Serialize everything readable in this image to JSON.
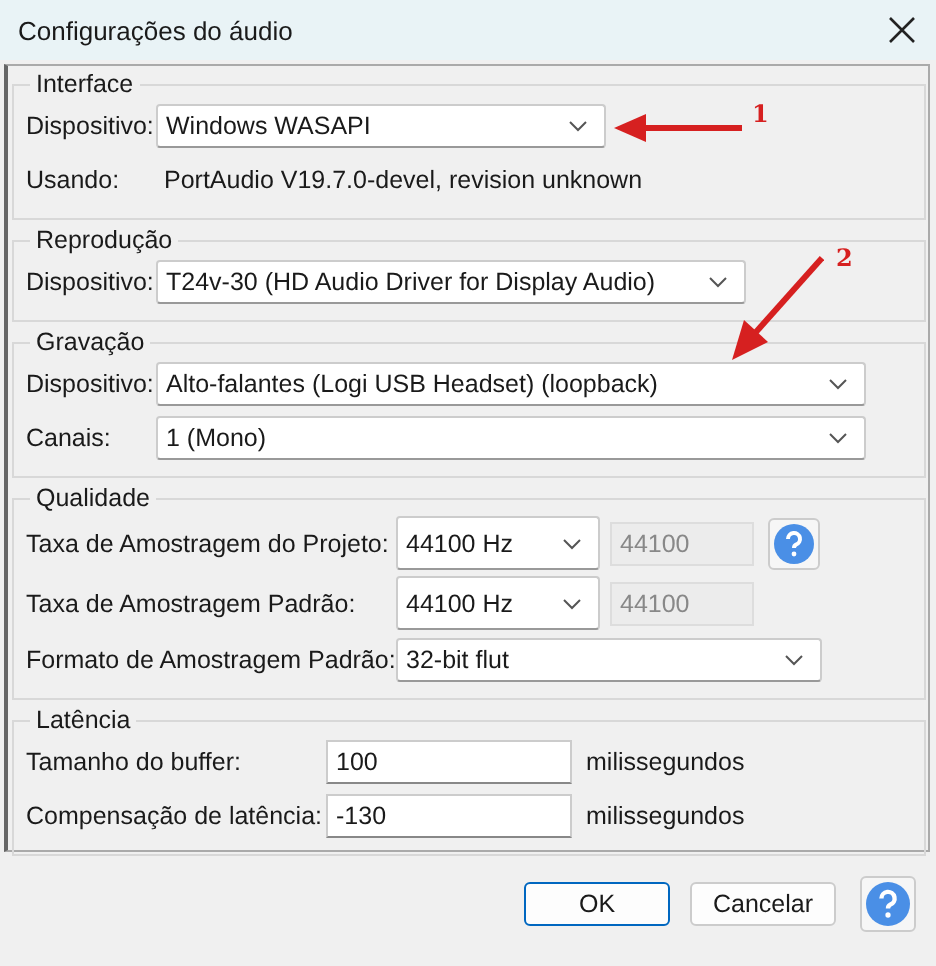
{
  "window": {
    "title": "Configurações do áudio"
  },
  "groups": [
    {
      "kind": "interface",
      "title": "Interface",
      "rows": [
        {
          "kind": "select",
          "label": "Dispositivo:",
          "value": "Windows WASAPI"
        },
        {
          "kind": "text",
          "label": "Usando:",
          "value": "PortAudio V19.7.0-devel, revision unknown"
        }
      ]
    },
    {
      "kind": "playback",
      "title": "Reprodução",
      "rows": [
        {
          "kind": "select",
          "label": "Dispositivo:",
          "value": "T24v-30 (HD Audio Driver for Display Audio)"
        }
      ]
    },
    {
      "kind": "recording",
      "title": "Gravação",
      "rows": [
        {
          "kind": "select",
          "label": "Dispositivo:",
          "value": "Alto-falantes (Logi USB Headset) (loopback)"
        },
        {
          "kind": "select",
          "label": "Canais:",
          "value": "1 (Mono)"
        }
      ]
    },
    {
      "kind": "quality",
      "title": "Qualidade",
      "rows": [
        {
          "kind": "rate",
          "label": "Taxa de Amostragem do Projeto:",
          "value": "44100 Hz",
          "field": {
            "value": "44100",
            "disabled": true
          },
          "help": true
        },
        {
          "kind": "rate",
          "label": "Taxa de Amostragem Padrão:",
          "value": "44100 Hz",
          "field": {
            "value": "44100",
            "disabled": true
          },
          "help": false
        },
        {
          "kind": "select",
          "label": "Formato de Amostragem Padrão:",
          "value": "32-bit flut"
        }
      ]
    },
    {
      "kind": "latency",
      "title": "Latência",
      "rows": [
        {
          "kind": "input",
          "label": "Tamanho do buffer:",
          "value": "100",
          "unit": "milissegundos"
        },
        {
          "kind": "input",
          "label": "Compensação de latência:",
          "value": "-130",
          "unit": "milissegundos"
        }
      ]
    }
  ],
  "buttons": [
    {
      "label": "OK",
      "default": true
    },
    {
      "label": "Cancelar",
      "default": false
    }
  ],
  "annotations": [
    {
      "number": "1"
    },
    {
      "number": "2"
    }
  ]
}
